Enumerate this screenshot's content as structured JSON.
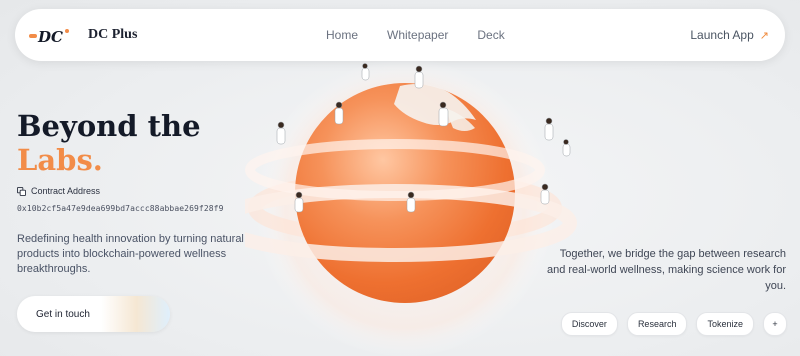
{
  "nav": {
    "brand": "DC Plus",
    "logo_text": "DC",
    "links": [
      "Home",
      "Whitepaper",
      "Deck"
    ],
    "launch_label": "Launch App"
  },
  "hero": {
    "title_line1": "Beyond the",
    "title_line2": "Labs.",
    "contract_label": "Contract Address",
    "contract_address": "0x10b2cf5a47e9dea699bd7accc88abbae269f28f9",
    "description": "Redefining health innovation by turning natural products into blockchain-powered wellness breakthroughs.",
    "cta_label": "Get in touch"
  },
  "side": {
    "text": "Together, we bridge the gap between research and real-world wellness, making science work for you.",
    "chips": [
      "Discover",
      "Research",
      "Tokenize",
      "+"
    ]
  },
  "colors": {
    "accent": "#f28c48",
    "orb": "#f07a3e"
  },
  "icons": {
    "logo": "dc-logo-icon",
    "launch": "arrow-up-right-icon",
    "contract": "copy-icon"
  }
}
